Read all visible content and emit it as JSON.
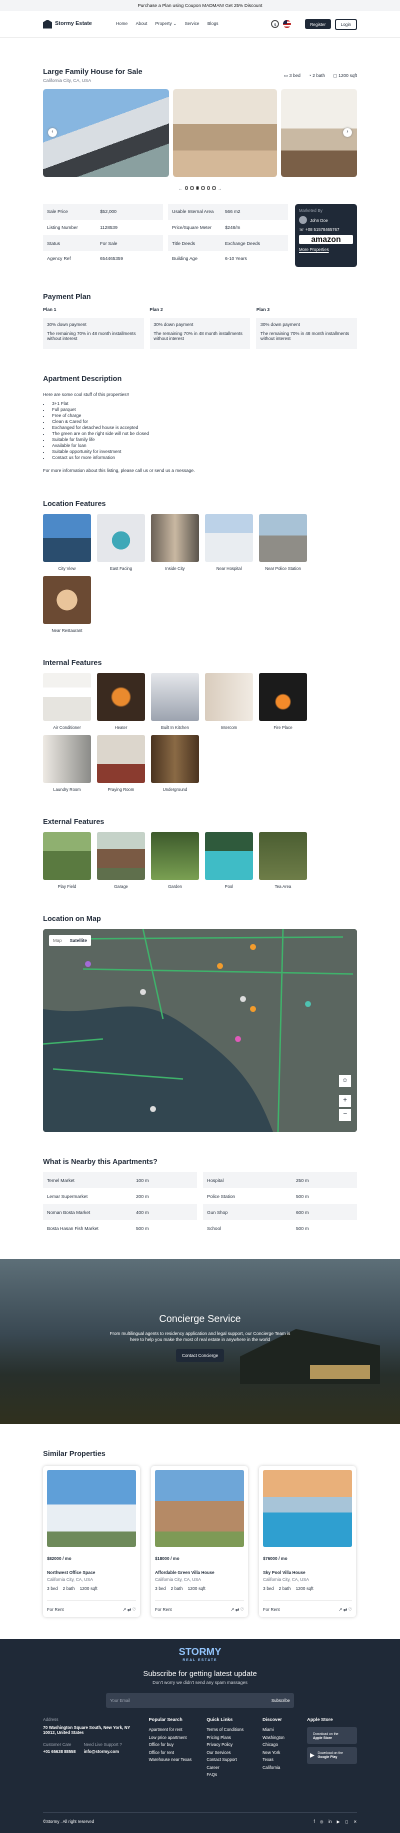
{
  "promo": "Purchase a Plan using Coupon MADMAN! Get 25% Discount",
  "brand": "Stormy Estate",
  "nav": {
    "home": "Home",
    "about": "About",
    "property": "Property",
    "service": "Service",
    "blogs": "Blogs",
    "currency": "$",
    "register": "Register",
    "login": "Login"
  },
  "listing": {
    "title": "Large Family House for Sale",
    "location": "California City, CA, USA",
    "beds": "3 bed",
    "baths": "2 bath",
    "area": "1200 sqft"
  },
  "details": {
    "left": [
      [
        "Sale Price",
        "$52,000"
      ],
      [
        "Listing Number",
        "1128539"
      ],
      [
        "Status",
        "For Sale"
      ],
      [
        "Agency Ref",
        "654465359"
      ]
    ],
    "right": [
      [
        "Usable Internal Area",
        "566 m2"
      ],
      [
        "Price/Square Meter",
        "$248/m"
      ],
      [
        "Title Deeds",
        "Exchange Deeds"
      ],
      [
        "Building Age",
        "6-10 Years"
      ]
    ]
  },
  "agent": {
    "label": "Marketed By",
    "name": "John Doe",
    "phone": "+08 51578465767",
    "company": "amazon",
    "more": "More Properties"
  },
  "payment": {
    "heading": "Payment Plan",
    "plans": [
      {
        "name": "Plan 1",
        "down": "30% down payment",
        "rest": "The remaining 70% in 48 month installments without interest"
      },
      {
        "name": "Plan 2",
        "down": "30% down payment",
        "rest": "The remaining 70% in 48 month installments without interest"
      },
      {
        "name": "Plan 3",
        "down": "30% down payment",
        "rest": "The remaining 70% in 48 month installments without interest"
      }
    ]
  },
  "description": {
    "heading": "Apartment Description",
    "intro": "Here are some cool stuff of this properties!!",
    "items": [
      "3+1 Flat",
      "Full parquet",
      "Free of charge",
      "Clean & Cared for",
      "Exchanged for detached house is accepted",
      "The green are on the right side will not be closed",
      "Suitable for family life",
      "Available for loan",
      "Suitable opportunity for investment",
      "Contact us for more information"
    ],
    "outro": "For more information about this listing, please call us or send us a message."
  },
  "location_features": {
    "heading": "Location Features",
    "items": [
      "City View",
      "East Facing",
      "Inside City",
      "Near Hospital",
      "Near Police Station",
      "Near Restaurant"
    ]
  },
  "internal_features": {
    "heading": "Internal Features",
    "items": [
      "Air Conditioner",
      "Heater",
      "Built In Kitchen",
      "Intercom",
      "Fire Place",
      "Laundry Room",
      "Praying Room",
      "Underground"
    ]
  },
  "external_features": {
    "heading": "External Features",
    "items": [
      "Play Field",
      "Garage",
      "Garden",
      "Pool",
      "Tea Area"
    ]
  },
  "map": {
    "heading": "Location on Map",
    "tab_map": "Map",
    "tab_satellite": "Satellite"
  },
  "nearby": {
    "heading": "What is Nearby this Apartments?",
    "left": [
      [
        "Temel Market",
        "100 m"
      ],
      [
        "Lemar Supermarket",
        "200 m"
      ],
      [
        "Noman Bosta Market",
        "400 m"
      ],
      [
        "Bosta Hasan Fish Market",
        "500 m"
      ]
    ],
    "right": [
      [
        "Hospital",
        "250 m"
      ],
      [
        "Police Station",
        "500 m"
      ],
      [
        "Gun Shop",
        "600 m"
      ],
      [
        "School",
        "500 m"
      ]
    ]
  },
  "concierge": {
    "title": "Concierge Service",
    "text": "From multilingual agents to residency application and legal support, our Concierge Team is here to help you make the most of real estate in anywhere in the world",
    "button": "Contact Concierge"
  },
  "similar": {
    "heading": "Similar Properties",
    "cards": [
      {
        "price": "$82000 / mo",
        "name": "Northwest Office Space",
        "loc": "California City, CA, USA",
        "bed": "3 bed",
        "bath": "2 bath",
        "area": "1200 sqft",
        "tag": "For Rent"
      },
      {
        "price": "$18000 / mo",
        "name": "Affordable Green Villa House",
        "loc": "California City, CA, USA",
        "bed": "3 bed",
        "bath": "2 bath",
        "area": "1200 sqft",
        "tag": "For Rent"
      },
      {
        "price": "$76000 / mo",
        "name": "Sky Pool Villa House",
        "loc": "California City, CA, USA",
        "bed": "3 bed",
        "bath": "2 bath",
        "area": "1200 sqft",
        "tag": "For Rent"
      }
    ]
  },
  "footer": {
    "logo": "STORMY",
    "logo_sub": "REAL ESTATE",
    "newsletter_title": "Subscribe for getting latest update",
    "newsletter_sub": "Don't worry we didn't send any spam massages",
    "email_placeholder": "Your Email",
    "subscribe": "Subscribe",
    "address_label": "Address",
    "address": "70 Washington Square South, New York, NY 10012, United States",
    "care_label": "Customer Care",
    "care_phone": "+01 65638 88558",
    "support_label": "Need Live Support ?",
    "support_email": "info@stormy.com",
    "popular": {
      "title": "Popular Search",
      "items": [
        "Apartment for rent",
        "Low price apartment",
        "Office for buy",
        "Office for rent",
        "Warehouse near Texas"
      ]
    },
    "quick": {
      "title": "Quick Links",
      "items": [
        "Terms of Conditions",
        "Pricing Plans",
        "Privacy Policy",
        "Our Services",
        "Contact Support",
        "Career",
        "FAQs"
      ]
    },
    "discover": {
      "title": "Discover",
      "items": [
        "Miami",
        "Washington",
        "Chicago",
        "New York",
        "Texas",
        "California"
      ]
    },
    "apple": {
      "title": "Apple Store",
      "a1": "Download on the",
      "a2": "Apple Store",
      "g1": "Download on the",
      "g2": "Google Play"
    },
    "copyright": "©Stormy . All right reserved"
  }
}
